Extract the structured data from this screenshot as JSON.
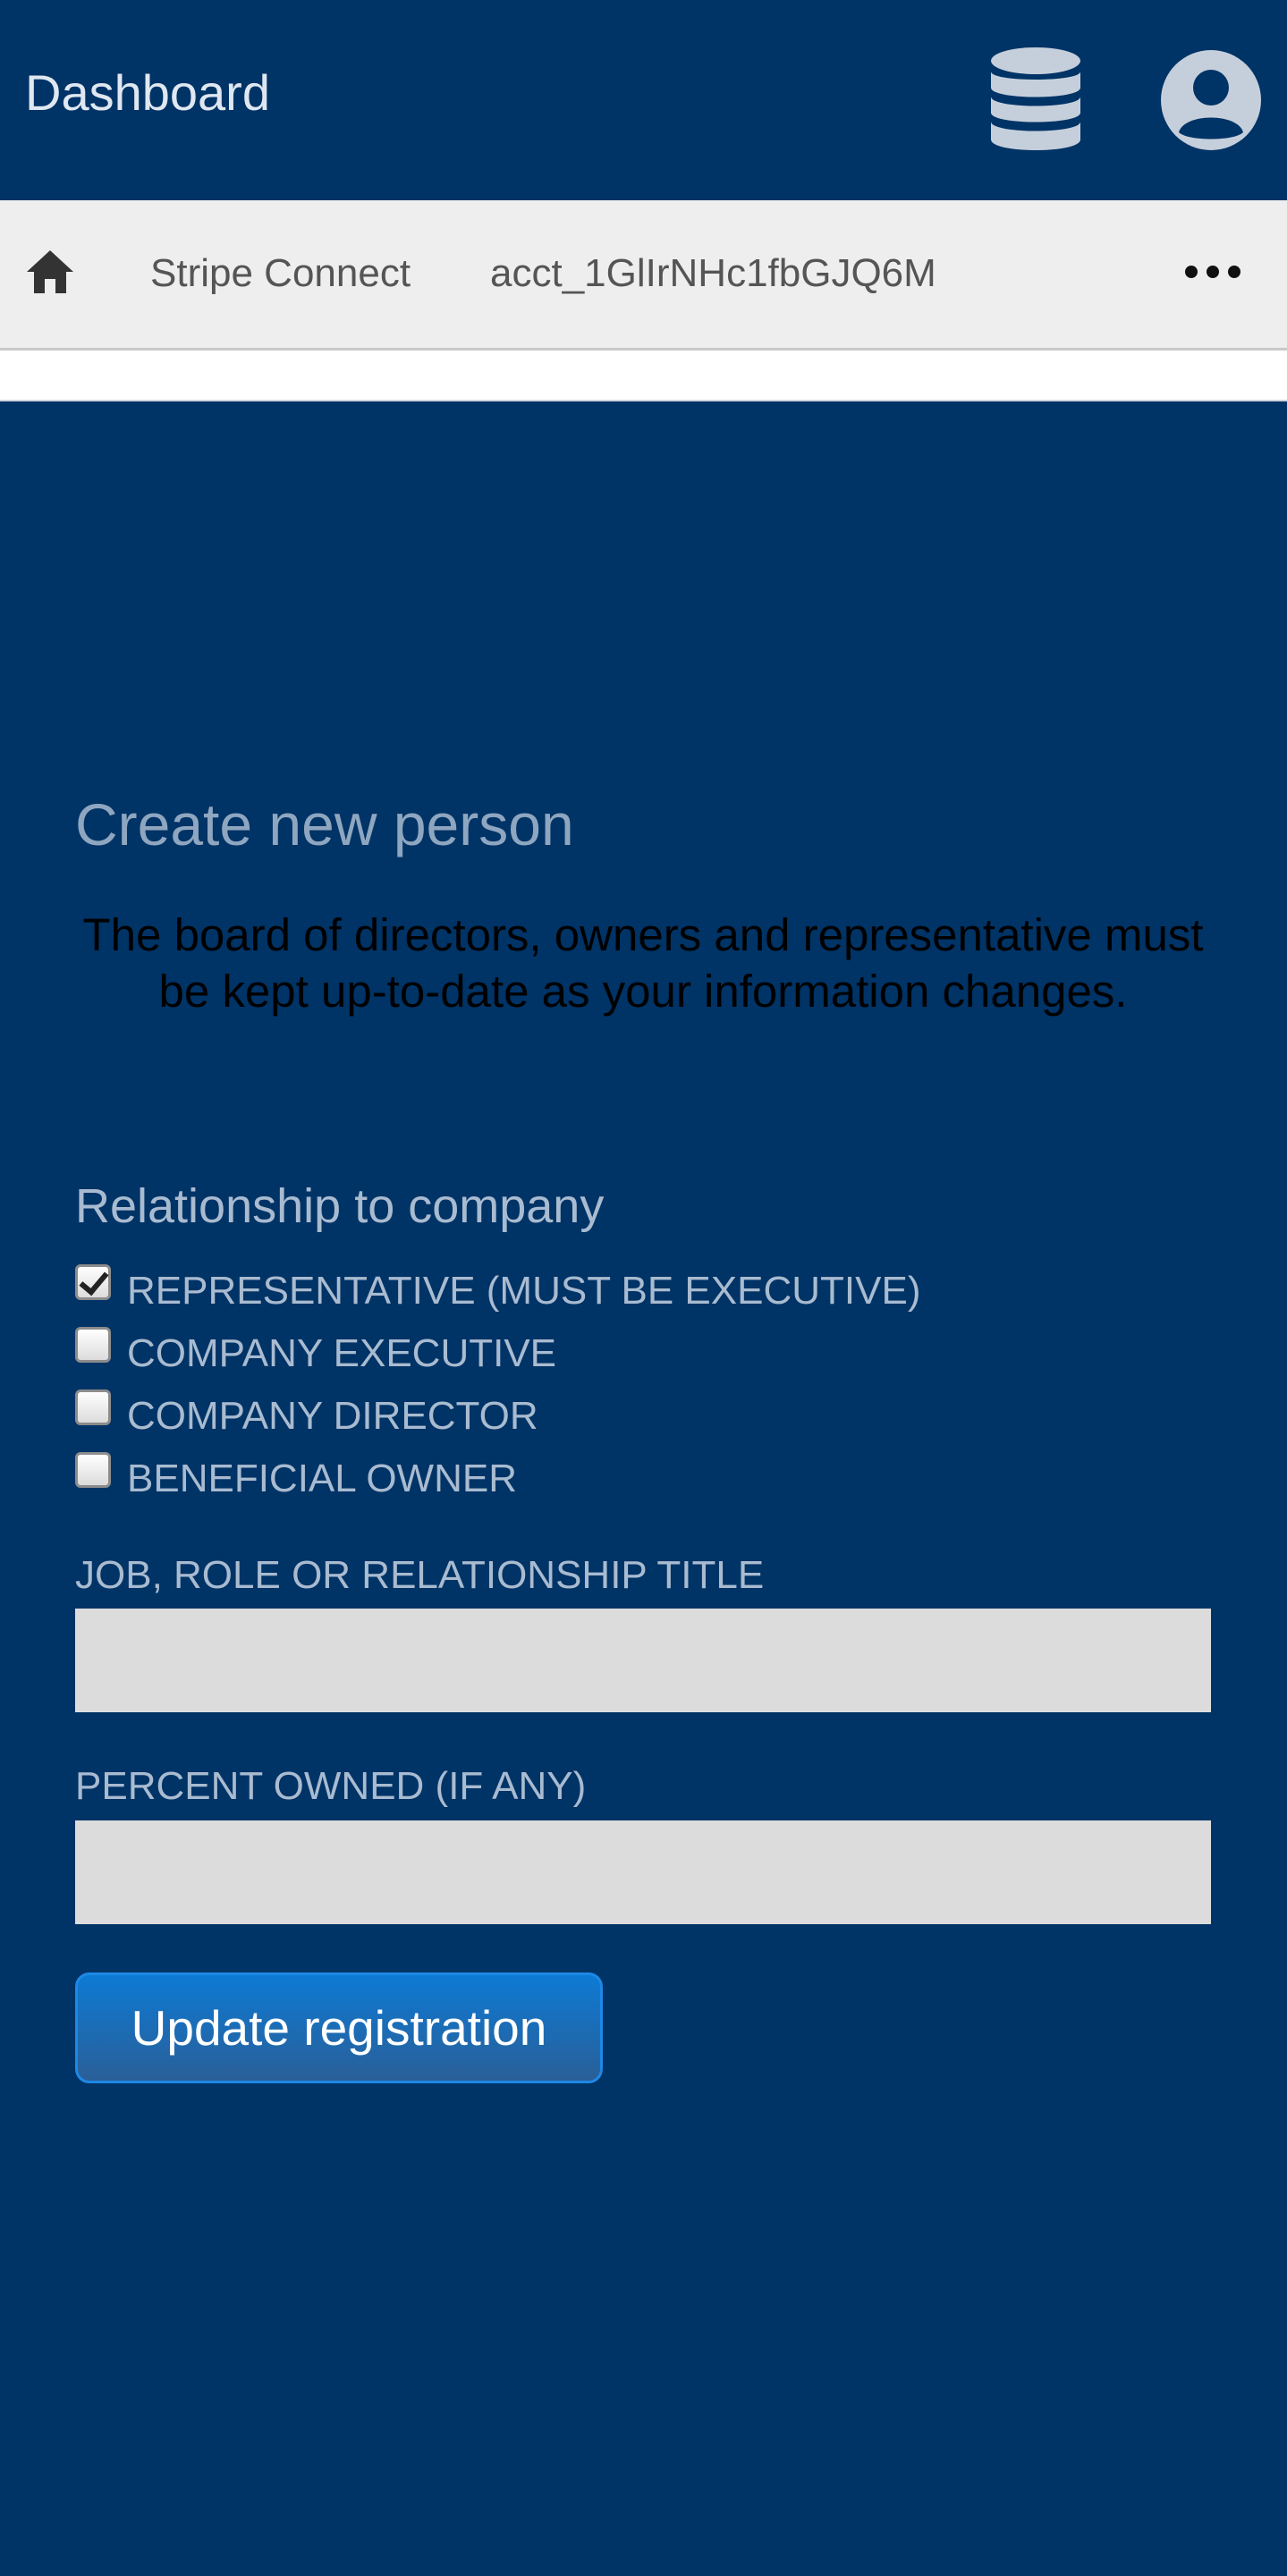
{
  "header": {
    "title": "Dashboard",
    "icons": {
      "database": "database-icon",
      "user": "user-circle-icon"
    }
  },
  "breadcrumb": {
    "home_icon": "home-icon",
    "items": [
      {
        "label": "Stripe Connect"
      },
      {
        "label": "acct_1GlIrNHc1fbGJQ6M"
      }
    ],
    "more_icon": "more-horizontal-icon"
  },
  "form": {
    "title": "Create new person",
    "notice": "The board of directors, owners and representative must be kept up-to-date as your information changes.",
    "relationship_title": "Relationship to company",
    "relationships": [
      {
        "label": "REPRESENTATIVE (MUST BE EXECUTIVE)",
        "checked": true
      },
      {
        "label": "COMPANY EXECUTIVE",
        "checked": false
      },
      {
        "label": "COMPANY DIRECTOR",
        "checked": false
      },
      {
        "label": "BENEFICIAL OWNER",
        "checked": false
      }
    ],
    "job_title_label": "JOB, ROLE OR RELATIONSHIP TITLE",
    "job_title_value": "",
    "percent_owned_label": "PERCENT OWNED (IF ANY)",
    "percent_owned_value": "",
    "submit_label": "Update registration"
  },
  "colors": {
    "background": "#003366",
    "breadcrumb_bar": "#eeeeee",
    "input_background": "#dcdcdc",
    "button_blue": "#0d7ad4",
    "muted_text": "#a9bbd0"
  }
}
